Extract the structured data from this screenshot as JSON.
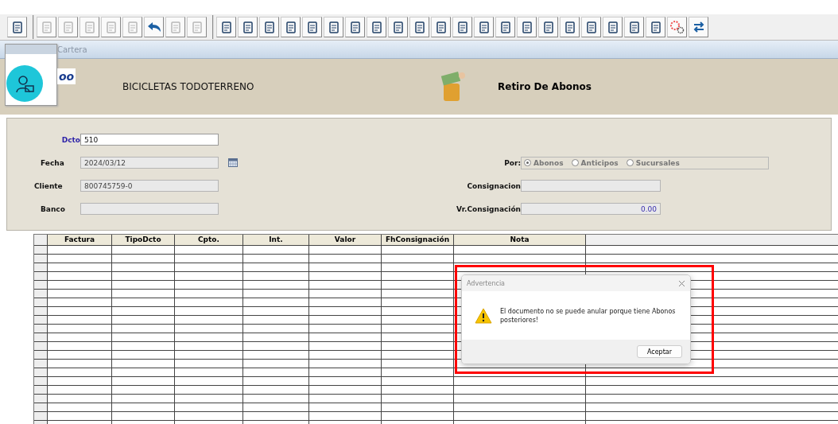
{
  "toolbar": {
    "groups": [
      [
        {
          "disabled": false
        }
      ],
      [
        {
          "disabled": true
        },
        {
          "disabled": true
        },
        {
          "disabled": true
        },
        {
          "disabled": true
        },
        {
          "disabled": true
        },
        {
          "disabled": false,
          "kind": "undo"
        },
        {
          "disabled": true
        },
        {
          "disabled": true
        }
      ],
      [
        {
          "disabled": false
        },
        {
          "disabled": false
        },
        {
          "disabled": false
        },
        {
          "disabled": false
        },
        {
          "disabled": false
        },
        {
          "disabled": false
        },
        {
          "disabled": false
        },
        {
          "disabled": false
        },
        {
          "disabled": false
        },
        {
          "disabled": false
        },
        {
          "disabled": false
        },
        {
          "disabled": false
        },
        {
          "disabled": false
        },
        {
          "disabled": false
        },
        {
          "disabled": false
        },
        {
          "disabled": false
        },
        {
          "disabled": false
        },
        {
          "disabled": false
        },
        {
          "disabled": false
        },
        {
          "disabled": false
        },
        {
          "disabled": false
        },
        {
          "disabled": false,
          "kind": "gears"
        },
        {
          "disabled": false,
          "kind": "swap"
        }
      ]
    ]
  },
  "tab": {
    "label": "Cartera"
  },
  "logo_fragment": "oo",
  "header": {
    "company": "BICICLETAS TODOTERRENO",
    "title": "Retiro De Abonos"
  },
  "form": {
    "left": [
      {
        "label": "Dcto",
        "value": "510",
        "disabled": false
      },
      {
        "label": "Fecha",
        "value": "2024/03/12",
        "disabled": true,
        "calendar": true
      },
      {
        "label": "Cliente",
        "value": "800745759-0",
        "disabled": true
      },
      {
        "label": "Banco",
        "disabled": true
      }
    ],
    "por": {
      "label": "Por:",
      "options": [
        {
          "label": "Abonos",
          "selected": true
        },
        {
          "label": "Anticipos",
          "selected": false
        },
        {
          "label": "Sucursales",
          "selected": false
        }
      ]
    },
    "right": [
      {
        "label": "Consignacion",
        "disabled": true
      },
      {
        "label": "Vr.Consignación",
        "value": "0.00",
        "disabled": true
      }
    ]
  },
  "table": {
    "columns": [
      "Factura",
      "TipoDcto",
      "Cpto.",
      "Int.",
      "Valor",
      "FhConsignación",
      "Nota"
    ]
  },
  "dialog": {
    "title": "Advertencia",
    "message": "El documento no se puede anular porque tiene Abonos posteriores!",
    "button": "Aceptar",
    "highlighted": true
  }
}
